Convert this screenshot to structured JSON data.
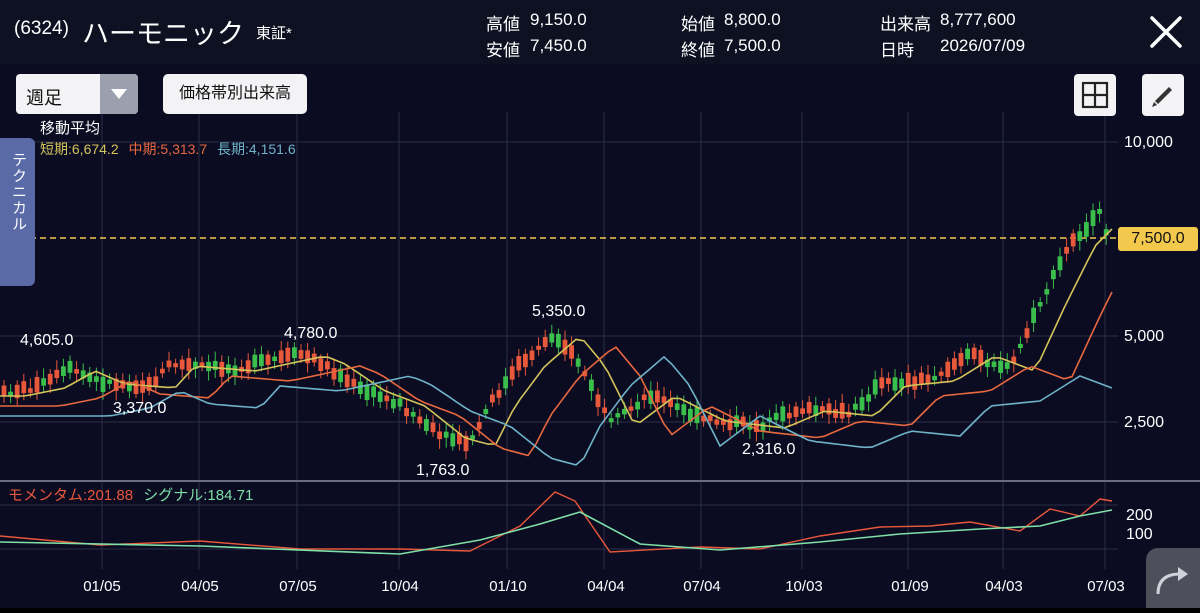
{
  "header": {
    "code": "(6324)",
    "name": "ハーモニック",
    "market": "東証*",
    "quotes": {
      "high_label": "高値",
      "high": "9,150.0",
      "low_label": "安値",
      "low": "7,450.0",
      "open_label": "始値",
      "open": "8,800.0",
      "close_label": "終値",
      "close": "7,500.0",
      "volume_label": "出来高",
      "volume": "8,777,600",
      "date_label": "日時",
      "date": "2026/07/09"
    },
    "close_icon": "close-icon"
  },
  "toolbar": {
    "period_selected": "週足",
    "volume_profile_button": "価格帯別出来高",
    "grid_icon": "grid-icon",
    "draw_icon": "pencil-icon"
  },
  "side_tab": {
    "label": "テクニカル"
  },
  "ma_legend": {
    "title": "移動平均",
    "short": "短期:6,674.2",
    "mid": "中期:5,313.7",
    "long": "長期:4,151.6"
  },
  "colors": {
    "up": "#3bbf4c",
    "down": "#e8583b",
    "ma_short": "#d4c45a",
    "ma_mid": "#e8693f",
    "ma_long": "#6fb3c8",
    "last_price_line": "#f2c94c",
    "momentum": "#e8583b",
    "signal": "#7fe0a8"
  },
  "chart_data": {
    "type": "candlestick",
    "y_scale": "log",
    "y_ticks": [
      "10,000",
      "5,000",
      "2,500"
    ],
    "x_ticks": [
      "01/05",
      "04/05",
      "07/05",
      "10/04",
      "01/10",
      "04/04",
      "07/04",
      "10/03",
      "01/09",
      "04/03",
      "07/03"
    ],
    "last_price": "7,500.0",
    "annotations": {
      "a1": "4,605.0",
      "a2": "3,370.0",
      "a3": "4,780.0",
      "a4": "1,763.0",
      "a5": "5,350.0",
      "a6": "2,316.0"
    },
    "momentum_panel": {
      "legend_momentum": "モメンタム:201.88",
      "legend_signal": "シグナル:184.71",
      "y_ticks": [
        "200",
        "100"
      ]
    }
  }
}
